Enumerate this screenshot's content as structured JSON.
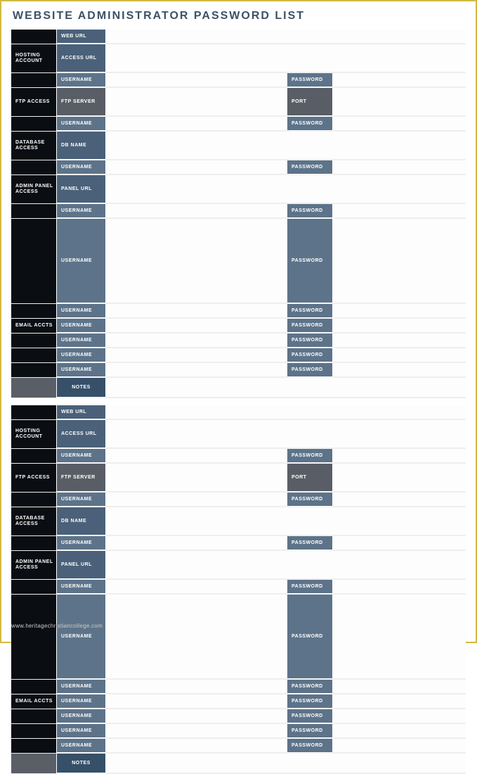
{
  "title": "WEBSITE ADMINISTRATOR PASSWORD LIST",
  "watermark": "www.heritagechristiancollege.com",
  "labels": {
    "web_url": "WEB URL",
    "hosting_account": "HOSTING ACCOUNT",
    "access_url": "ACCESS URL",
    "username": "USERNAME",
    "password": "PASSWORD",
    "ftp_access": "FTP ACCESS",
    "ftp_server": "FTP SERVER",
    "port": "PORT",
    "database_access": "DATABASE ACCESS",
    "db_name": "DB NAME",
    "admin_panel_access": "ADMIN PANEL ACCESS",
    "panel_url": "PANEL URL",
    "email_accts": "EMAIL ACCTS",
    "notes": "NOTES"
  },
  "blocks": [
    {
      "sections": [
        {
          "name": "",
          "rows": [
            {
              "left": {
                "key": "web_url",
                "class": "blue-mid"
              },
              "wide": true
            }
          ]
        },
        {
          "name": "hosting_account",
          "rows": [
            {
              "left": {
                "key": "access_url",
                "class": "blue-mid"
              },
              "wide": true
            },
            {
              "left": {
                "key": "username",
                "class": "blue-light"
              },
              "right": {
                "key": "password",
                "class": "blue-light"
              }
            }
          ]
        },
        {
          "name": "ftp_access",
          "rows": [
            {
              "left": {
                "key": "ftp_server",
                "class": "grey-dark"
              },
              "right": {
                "key": "port",
                "class": "grey-dark"
              }
            },
            {
              "left": {
                "key": "username",
                "class": "blue-light"
              },
              "right": {
                "key": "password",
                "class": "blue-light"
              }
            }
          ]
        },
        {
          "name": "database_access",
          "rows": [
            {
              "left": {
                "key": "db_name",
                "class": "blue-mid"
              },
              "wide": true
            },
            {
              "left": {
                "key": "username",
                "class": "blue-light"
              },
              "right": {
                "key": "password",
                "class": "blue-light"
              }
            }
          ]
        },
        {
          "name": "admin_panel_access",
          "rows": [
            {
              "left": {
                "key": "panel_url",
                "class": "blue-mid"
              },
              "wide": true
            },
            {
              "left": {
                "key": "username",
                "class": "blue-light"
              },
              "right": {
                "key": "password",
                "class": "blue-light"
              }
            }
          ]
        },
        {
          "name": "email_accts",
          "rows": [
            {
              "left": {
                "key": "username",
                "class": "blue-light"
              },
              "right": {
                "key": "password",
                "class": "blue-light"
              }
            },
            {
              "left": {
                "key": "username",
                "class": "blue-light"
              },
              "right": {
                "key": "password",
                "class": "blue-light"
              }
            },
            {
              "left": {
                "key": "username",
                "class": "blue-light"
              },
              "right": {
                "key": "password",
                "class": "blue-light"
              }
            },
            {
              "left": {
                "key": "username",
                "class": "blue-light"
              },
              "right": {
                "key": "password",
                "class": "blue-light"
              }
            },
            {
              "left": {
                "key": "username",
                "class": "blue-light"
              },
              "right": {
                "key": "password",
                "class": "blue-light"
              }
            },
            {
              "left": {
                "key": "username",
                "class": "blue-light"
              },
              "right": {
                "key": "password",
                "class": "blue-light"
              }
            }
          ]
        },
        {
          "name": "notes_blank",
          "rows": [
            {
              "left": {
                "key": "notes",
                "class": "blue-dark",
                "notes": true
              },
              "wide": true,
              "notes": true
            }
          ]
        }
      ]
    },
    {
      "sections": [
        {
          "name": "",
          "rows": [
            {
              "left": {
                "key": "web_url",
                "class": "blue-mid"
              },
              "wide": true
            }
          ]
        },
        {
          "name": "hosting_account",
          "rows": [
            {
              "left": {
                "key": "access_url",
                "class": "blue-mid"
              },
              "wide": true
            },
            {
              "left": {
                "key": "username",
                "class": "blue-light"
              },
              "right": {
                "key": "password",
                "class": "blue-light"
              }
            }
          ]
        },
        {
          "name": "ftp_access",
          "rows": [
            {
              "left": {
                "key": "ftp_server",
                "class": "grey-dark"
              },
              "right": {
                "key": "port",
                "class": "grey-dark"
              }
            },
            {
              "left": {
                "key": "username",
                "class": "blue-light"
              },
              "right": {
                "key": "password",
                "class": "blue-light"
              }
            }
          ]
        },
        {
          "name": "database_access",
          "rows": [
            {
              "left": {
                "key": "db_name",
                "class": "blue-mid"
              },
              "wide": true
            },
            {
              "left": {
                "key": "username",
                "class": "blue-light"
              },
              "right": {
                "key": "password",
                "class": "blue-light"
              }
            }
          ]
        },
        {
          "name": "admin_panel_access",
          "rows": [
            {
              "left": {
                "key": "panel_url",
                "class": "blue-mid"
              },
              "wide": true
            },
            {
              "left": {
                "key": "username",
                "class": "blue-light"
              },
              "right": {
                "key": "password",
                "class": "blue-light"
              }
            }
          ]
        },
        {
          "name": "email_accts",
          "rows": [
            {
              "left": {
                "key": "username",
                "class": "blue-light"
              },
              "right": {
                "key": "password",
                "class": "blue-light"
              }
            },
            {
              "left": {
                "key": "username",
                "class": "blue-light"
              },
              "right": {
                "key": "password",
                "class": "blue-light"
              }
            },
            {
              "left": {
                "key": "username",
                "class": "blue-light"
              },
              "right": {
                "key": "password",
                "class": "blue-light"
              }
            },
            {
              "left": {
                "key": "username",
                "class": "blue-light"
              },
              "right": {
                "key": "password",
                "class": "blue-light"
              }
            },
            {
              "left": {
                "key": "username",
                "class": "blue-light"
              },
              "right": {
                "key": "password",
                "class": "blue-light"
              }
            },
            {
              "left": {
                "key": "username",
                "class": "blue-light"
              },
              "right": {
                "key": "password",
                "class": "blue-light"
              }
            }
          ]
        },
        {
          "name": "notes_blank",
          "rows": [
            {
              "left": {
                "key": "notes",
                "class": "blue-dark",
                "notes": true
              },
              "wide": true,
              "notes": true
            }
          ]
        }
      ]
    }
  ]
}
